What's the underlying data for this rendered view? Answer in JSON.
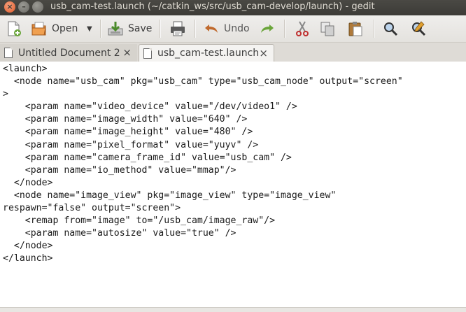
{
  "window": {
    "title": "usb_cam-test.launch (~/catkin_ws/src/usb_cam-develop/launch) - gedit"
  },
  "toolbar": {
    "open_label": "Open",
    "save_label": "Save",
    "undo_label": "Undo",
    "icons": [
      "new-document-icon",
      "open-folder-icon",
      "dropdown-arrow-icon",
      "save-icon",
      "print-icon",
      "undo-icon",
      "redo-icon",
      "cut-icon",
      "copy-icon",
      "paste-icon",
      "find-icon",
      "find-replace-icon"
    ]
  },
  "tabs": [
    {
      "label": "Untitled Document 2",
      "close": "×"
    },
    {
      "label": "usb_cam-test.launch",
      "close": "×"
    }
  ],
  "editor": {
    "lines": [
      "<launch>",
      "  <node name=\"usb_cam\" pkg=\"usb_cam\" type=\"usb_cam_node\" output=\"screen\"",
      ">",
      "    <param name=\"video_device\" value=\"/dev/video1\" />",
      "    <param name=\"image_width\" value=\"640\" />",
      "    <param name=\"image_height\" value=\"480\" />",
      "    <param name=\"pixel_format\" value=\"yuyv\" />",
      "    <param name=\"camera_frame_id\" value=\"usb_cam\" />",
      "    <param name=\"io_method\" value=\"mmap\"/>",
      "  </node>",
      "  <node name=\"image_view\" pkg=\"image_view\" type=\"image_view\"",
      "respawn=\"false\" output=\"screen\">",
      "    <remap from=\"image\" to=\"/usb_cam/image_raw\"/>",
      "    <param name=\"autosize\" value=\"true\" />",
      "  </node>",
      "</launch>"
    ]
  }
}
